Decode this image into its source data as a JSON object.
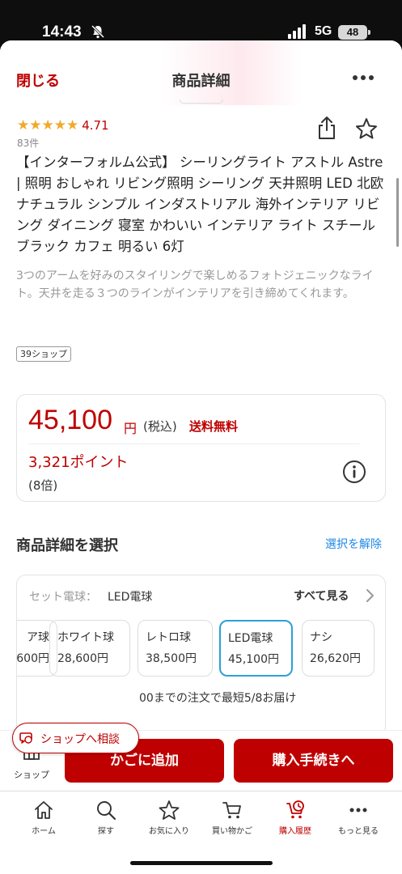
{
  "status_bar": {
    "time": "14:43",
    "network": "5G",
    "battery": "48"
  },
  "header": {
    "close_label": "閉じる",
    "title": "商品詳細"
  },
  "rating": {
    "stars": "★★★★★",
    "value": "4.71",
    "count": "83件"
  },
  "product": {
    "title": "【インターフォルム公式】 シーリングライト アストル Astre | 照明 おしゃれ リビング照明 シーリング 天井照明 LED 北欧 ナチュラル シンプル インダストリアル 海外インテリア リビング ダイニング 寝室 かわいい インテリア ライト スチール ブラック カフェ 明るい 6灯",
    "description": "3つのアームを好みのスタイリングで楽しめるフォトジェニックなライト。天井を走る３つのラインがインテリアを引き締めてくれます。",
    "shop_badge": "39ショップ"
  },
  "price": {
    "amount": "45,100",
    "yen": "円",
    "tax": "(税込)",
    "shipping": "送料無料",
    "points": "3,321ポイント",
    "multiplier": "(8倍)"
  },
  "selection": {
    "title": "商品詳細を選択",
    "clear_label": "選択を解除",
    "variant_label": "セット電球：",
    "variant_value": "LED電球",
    "see_all": "すべて見る",
    "options": [
      {
        "name": "ア球",
        "price": "600円"
      },
      {
        "name": "ホワイト球",
        "price": "28,600円"
      },
      {
        "name": "レトロ球",
        "price": "38,500円"
      },
      {
        "name": "LED電球",
        "price": "45,100円"
      },
      {
        "name": "ナシ",
        "price": "26,620円"
      }
    ],
    "selected_index": 3
  },
  "consult_label": "ショップへ相談",
  "delivery_text": "00までの注文で最短5/8お届け",
  "action_bar": {
    "shop_label": "ショップ",
    "cart_label": "かごに追加",
    "checkout_label": "購入手続きへ"
  },
  "tabbar": [
    {
      "label": "ホーム",
      "icon": "home-icon"
    },
    {
      "label": "探す",
      "icon": "search-icon"
    },
    {
      "label": "お気に入り",
      "icon": "star-icon"
    },
    {
      "label": "買い物かご",
      "icon": "cart-icon"
    },
    {
      "label": "購入履歴",
      "icon": "history-icon"
    },
    {
      "label": "もっと見る",
      "icon": "more-icon"
    }
  ],
  "colors": {
    "brand": "#bf0000",
    "link": "#1e88e5",
    "star": "#f0a929",
    "selected_border": "#2d9fd9"
  }
}
